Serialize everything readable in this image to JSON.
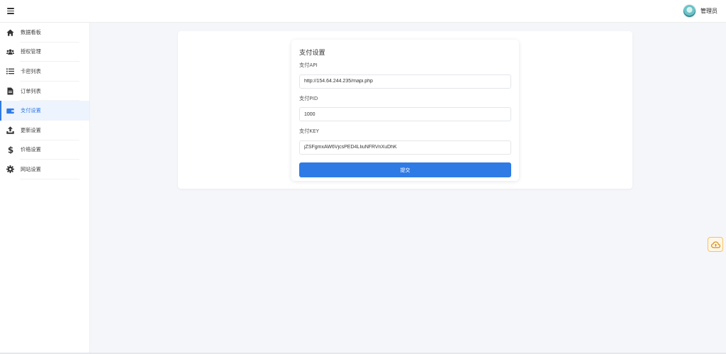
{
  "header": {
    "user_name": "管理员"
  },
  "sidebar": {
    "items": [
      {
        "label": "数据看板",
        "icon": "home-icon"
      },
      {
        "label": "授权管理",
        "icon": "users-icon"
      },
      {
        "label": "卡密列表",
        "icon": "list-icon"
      },
      {
        "label": "订单列表",
        "icon": "document-icon"
      },
      {
        "label": "支付设置",
        "icon": "wallet-icon",
        "active": true
      },
      {
        "label": "更新设置",
        "icon": "upload-icon"
      },
      {
        "label": "价格设置",
        "icon": "dollar-icon"
      },
      {
        "label": "网站设置",
        "icon": "gear-icon"
      }
    ]
  },
  "form": {
    "title": "支付设置",
    "api_label": "支付API",
    "api_value": "http://154.64.244.235/mapi.php",
    "pid_label": "支付PID",
    "pid_value": "1000",
    "key_label": "支付KEY",
    "key_value": "jZSFgmxAW6VjcsPED4LIiuNFRVnXuDhK",
    "submit_label": "提交"
  },
  "colors": {
    "accent": "#2f7be5",
    "float_border": "#f2c36b"
  }
}
